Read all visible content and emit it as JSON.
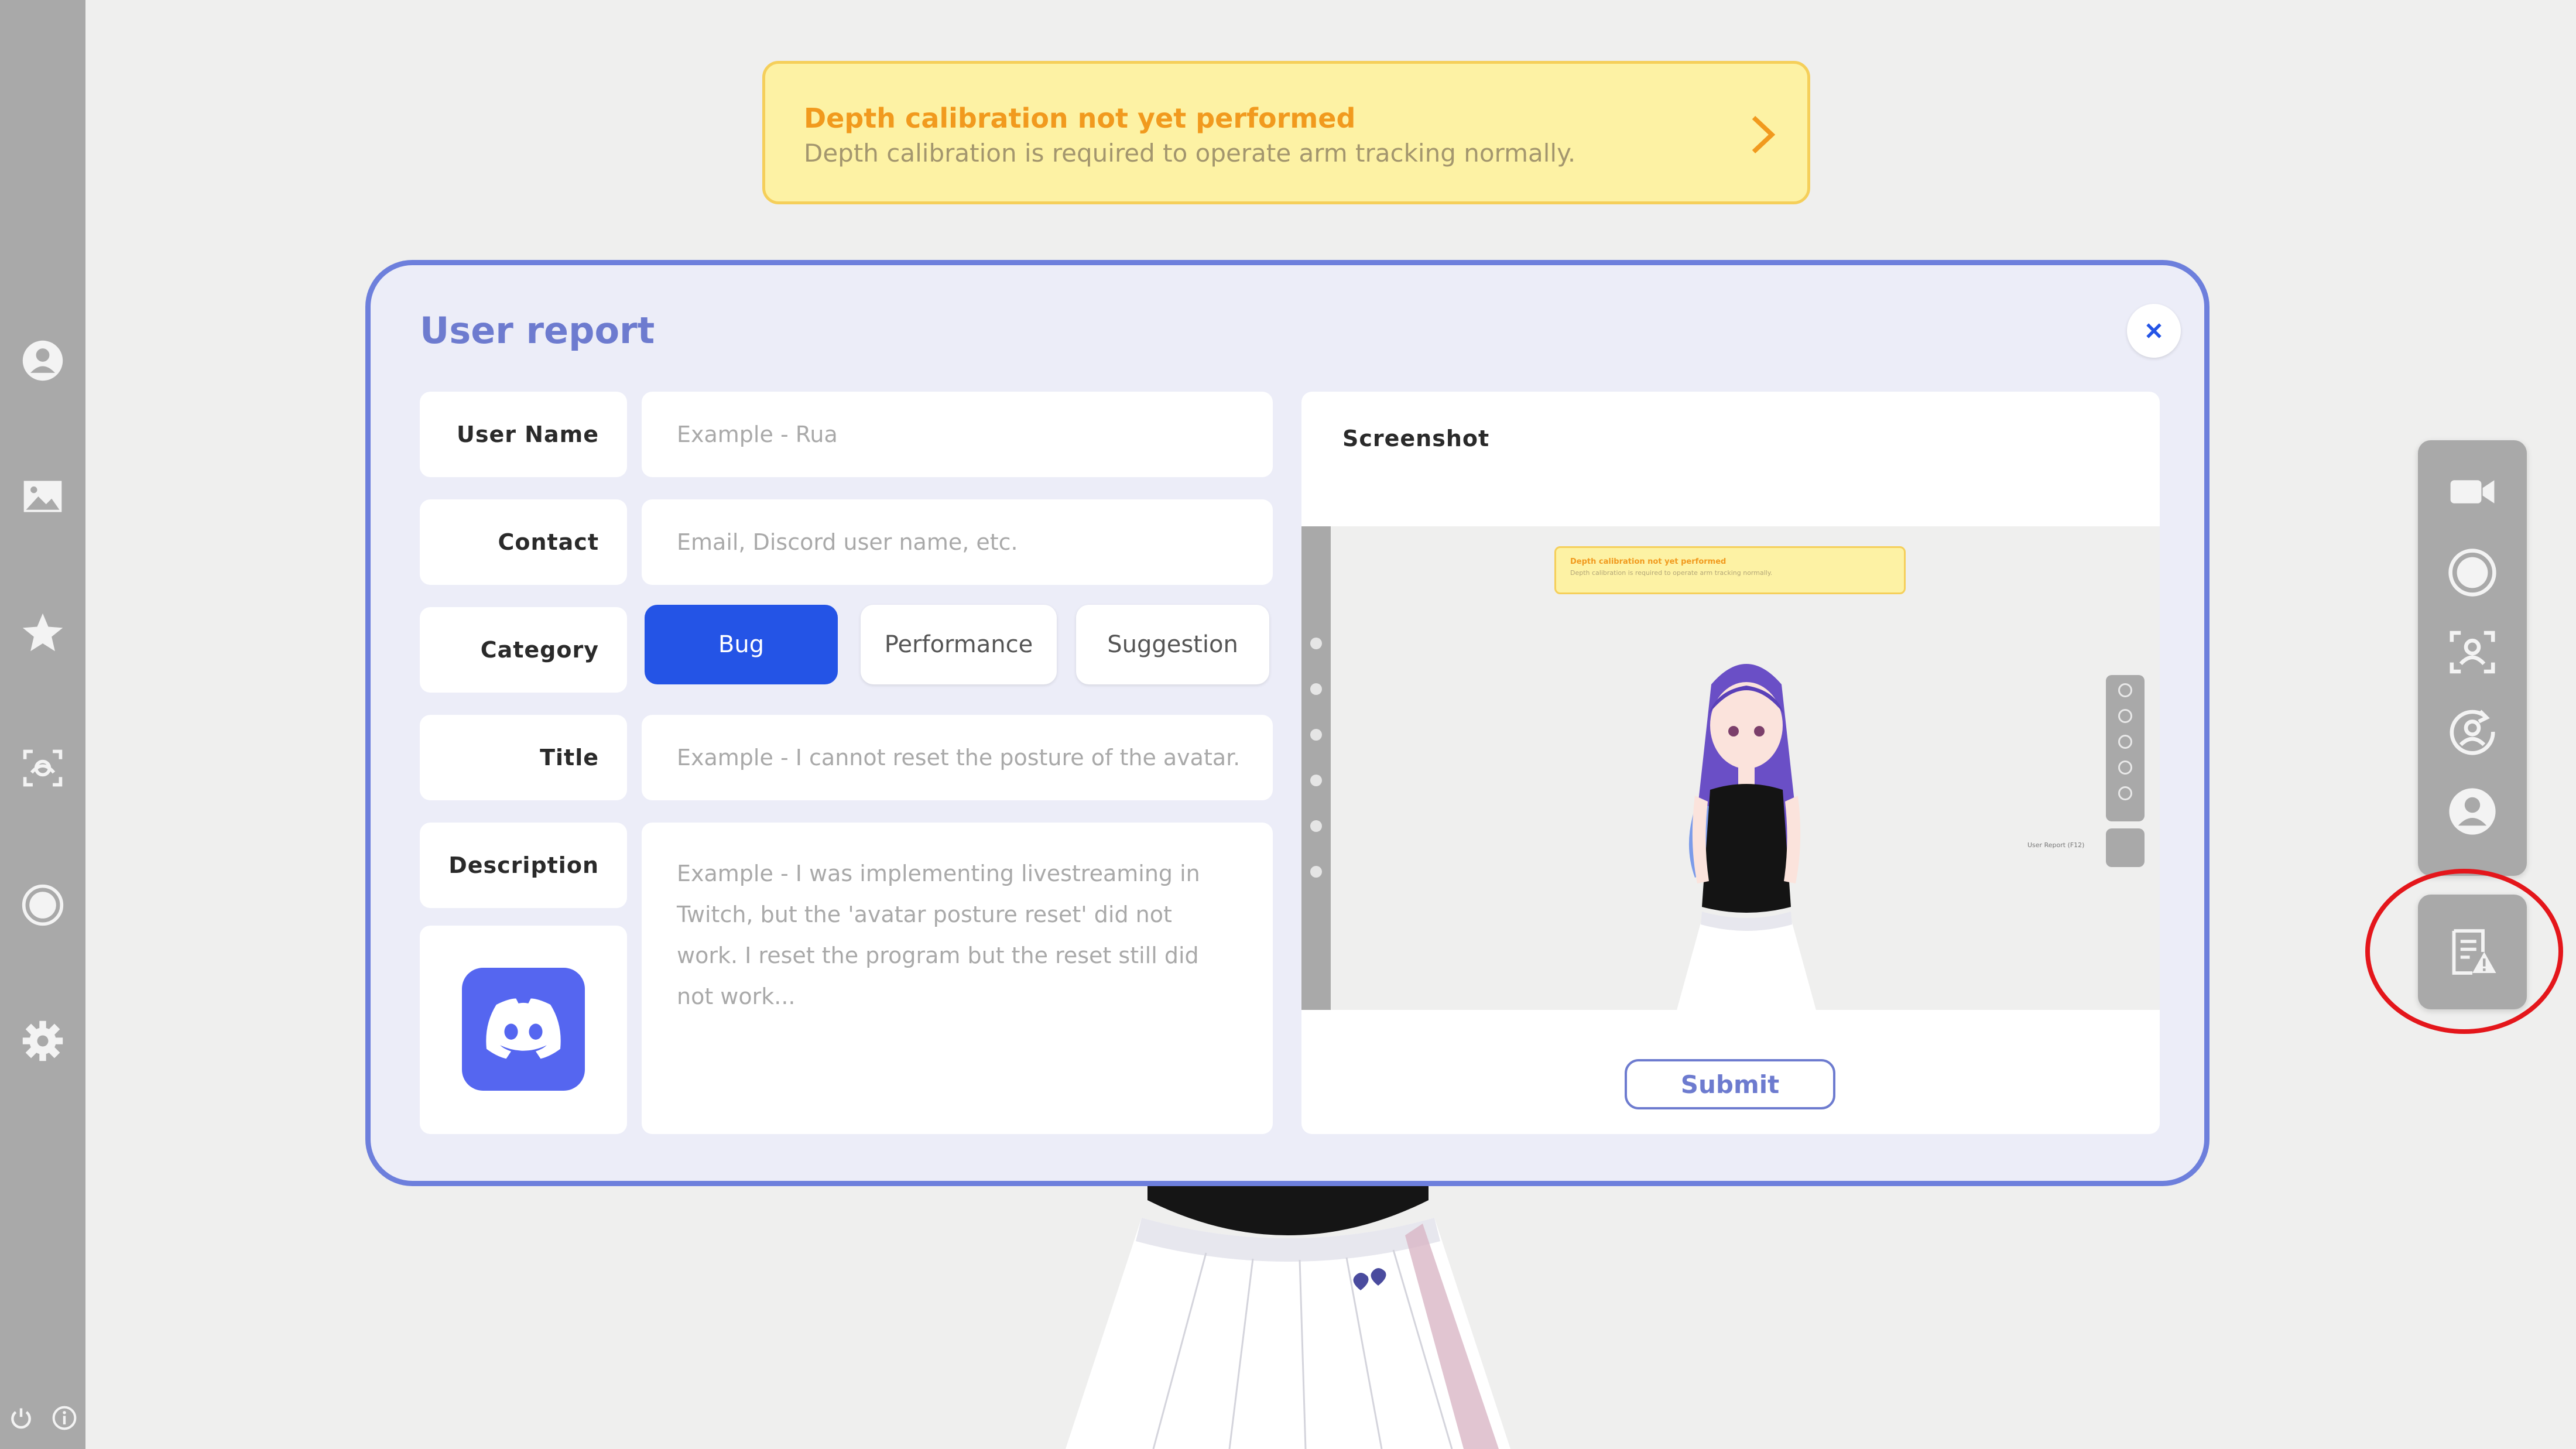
{
  "notification": {
    "title": "Depth calibration not yet performed",
    "description": "Depth calibration is required to operate arm tracking normally."
  },
  "dialog": {
    "title": "User report",
    "fields": {
      "user_name": {
        "label": "User Name",
        "placeholder": "Example - Rua"
      },
      "contact": {
        "label": "Contact",
        "placeholder": "Email, Discord user name, etc."
      },
      "category": {
        "label": "Category",
        "options": [
          "Bug",
          "Performance",
          "Suggestion"
        ],
        "selected": "Bug"
      },
      "title": {
        "label": "Title",
        "placeholder": "Example - I cannot reset the posture of the avatar."
      },
      "description": {
        "label": "Description",
        "placeholder": "Example - I was implementing livestreaming in Twitch, but the 'avatar posture reset' did not work. I reset the program but the reset still did not work..."
      }
    },
    "screenshot": {
      "label": "Screenshot",
      "preview": {
        "banner_title": "Depth calibration not yet performed",
        "banner_desc": "Depth calibration is required to operate arm tracking normally.",
        "report_label": "User Report (F12)"
      }
    },
    "submit_label": "Submit"
  },
  "icons": {
    "left_sidebar": [
      "user-icon",
      "image-icon",
      "effects-icon",
      "face-tracking-icon",
      "record-icon",
      "settings-icon"
    ],
    "left_bottom": [
      "power-icon",
      "info-icon"
    ],
    "right_toolbar": [
      "camera-icon",
      "record-icon",
      "face-scan-icon",
      "reset-pose-icon",
      "avatar-icon"
    ],
    "report": "user-report-icon"
  },
  "colors": {
    "accent": "#6d7fdc",
    "selected_category": "#2454e6",
    "banner_bg": "#fdf2a4",
    "banner_title": "#f19a1e",
    "highlight": "#e4161b",
    "sidebar": "#a9a9a9"
  }
}
